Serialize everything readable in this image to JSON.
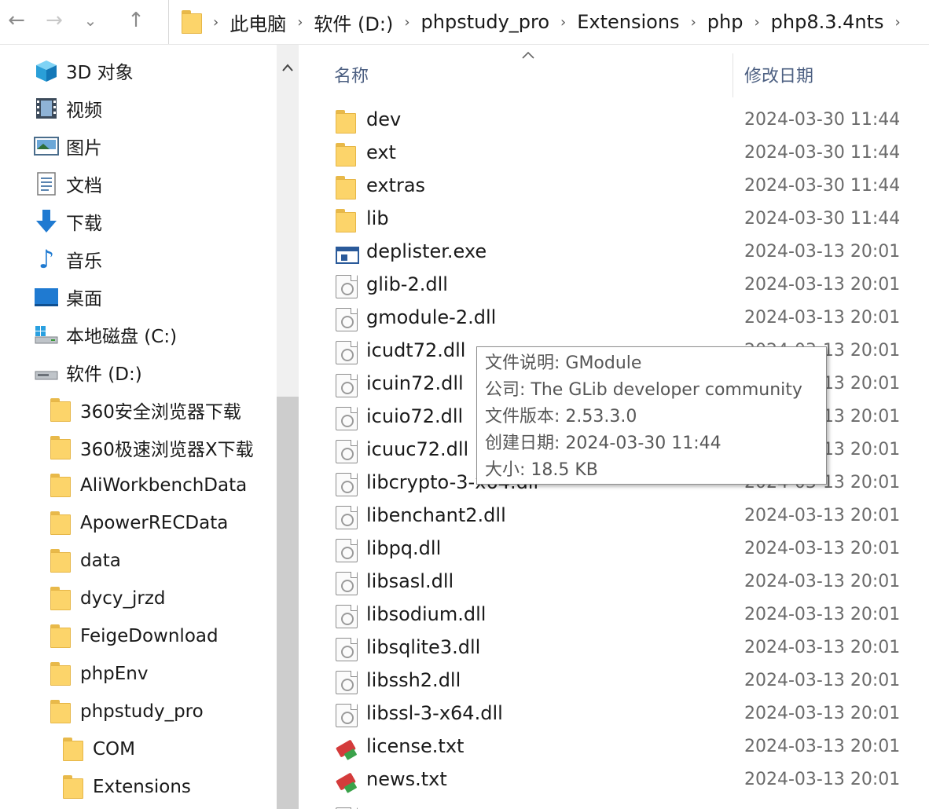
{
  "toolbar": {
    "back_icon": "←",
    "forward_icon": "→",
    "recent_icon": "⌄",
    "up_icon": "↑"
  },
  "breadcrumb": [
    "此电脑",
    "软件 (D:)",
    "phpstudy_pro",
    "Extensions",
    "php",
    "php8.3.4nts"
  ],
  "breadcrumb_sep": "›",
  "sidebar": {
    "items": [
      {
        "label": "3D 对象",
        "icon": "3d-objects-icon",
        "level": 0
      },
      {
        "label": "视频",
        "icon": "video-icon",
        "level": 0
      },
      {
        "label": "图片",
        "icon": "pictures-icon",
        "level": 0
      },
      {
        "label": "文档",
        "icon": "documents-icon",
        "level": 0
      },
      {
        "label": "下载",
        "icon": "download-icon",
        "level": 0
      },
      {
        "label": "音乐",
        "icon": "music-icon",
        "level": 0
      },
      {
        "label": "桌面",
        "icon": "desktop-icon",
        "level": 0
      },
      {
        "label": "本地磁盘 (C:)",
        "icon": "drive-c-icon",
        "level": 0
      },
      {
        "label": "软件 (D:)",
        "icon": "drive-d-icon",
        "level": 0
      },
      {
        "label": "360安全浏览器下载",
        "icon": "folder-icon",
        "level": 1
      },
      {
        "label": "360极速浏览器X下载",
        "icon": "folder-icon",
        "level": 1
      },
      {
        "label": "AliWorkbenchData",
        "icon": "folder-icon",
        "level": 1
      },
      {
        "label": "ApowerRECData",
        "icon": "folder-icon",
        "level": 1
      },
      {
        "label": "data",
        "icon": "folder-icon",
        "level": 1
      },
      {
        "label": "dycy_jrzd",
        "icon": "folder-icon",
        "level": 1
      },
      {
        "label": "FeigeDownload",
        "icon": "folder-icon",
        "level": 1
      },
      {
        "label": "phpEnv",
        "icon": "folder-icon",
        "level": 1
      },
      {
        "label": "phpstudy_pro",
        "icon": "folder-icon",
        "level": 1
      },
      {
        "label": "COM",
        "icon": "folder-icon",
        "level": 2
      },
      {
        "label": "Extensions",
        "icon": "folder-icon",
        "level": 2
      }
    ]
  },
  "columns": {
    "name": "名称",
    "modified": "修改日期"
  },
  "files": [
    {
      "name": "dev",
      "date": "2024-03-30 11:44",
      "type": "folder"
    },
    {
      "name": "ext",
      "date": "2024-03-30 11:44",
      "type": "folder"
    },
    {
      "name": "extras",
      "date": "2024-03-30 11:44",
      "type": "folder"
    },
    {
      "name": "lib",
      "date": "2024-03-30 11:44",
      "type": "folder"
    },
    {
      "name": "deplister.exe",
      "date": "2024-03-13 20:01",
      "type": "exe"
    },
    {
      "name": "glib-2.dll",
      "date": "2024-03-13 20:01",
      "type": "dll"
    },
    {
      "name": "gmodule-2.dll",
      "date": "2024-03-13 20:01",
      "type": "dll"
    },
    {
      "name": "icudt72.dll",
      "date": "2024-03-13 20:01",
      "type": "dll"
    },
    {
      "name": "icuin72.dll",
      "date": "2024-03-13 20:01",
      "type": "dll"
    },
    {
      "name": "icuio72.dll",
      "date": "2024-03-13 20:01",
      "type": "dll"
    },
    {
      "name": "icuuc72.dll",
      "date": "2024-03-13 20:01",
      "type": "dll"
    },
    {
      "name": "libcrypto-3-x64.dll",
      "date": "2024-03-13 20:01",
      "type": "dll"
    },
    {
      "name": "libenchant2.dll",
      "date": "2024-03-13 20:01",
      "type": "dll"
    },
    {
      "name": "libpq.dll",
      "date": "2024-03-13 20:01",
      "type": "dll"
    },
    {
      "name": "libsasl.dll",
      "date": "2024-03-13 20:01",
      "type": "dll"
    },
    {
      "name": "libsodium.dll",
      "date": "2024-03-13 20:01",
      "type": "dll"
    },
    {
      "name": "libsqlite3.dll",
      "date": "2024-03-13 20:01",
      "type": "dll"
    },
    {
      "name": "libssh2.dll",
      "date": "2024-03-13 20:01",
      "type": "dll"
    },
    {
      "name": "libssl-3-x64.dll",
      "date": "2024-03-13 20:01",
      "type": "dll"
    },
    {
      "name": "license.txt",
      "date": "2024-03-13 20:01",
      "type": "txt"
    },
    {
      "name": "news.txt",
      "date": "2024-03-13 20:01",
      "type": "txt"
    }
  ],
  "tooltip": {
    "lines": [
      "文件说明: GModule",
      "公司: The GLib developer community",
      "文件版本: 2.53.3.0",
      "创建日期: 2024-03-30 11:44",
      "大小: 18.5 KB"
    ]
  },
  "colors": {
    "folder": "#fcd46a",
    "header_text": "#4d6082",
    "date_text": "#6b6b6b"
  }
}
